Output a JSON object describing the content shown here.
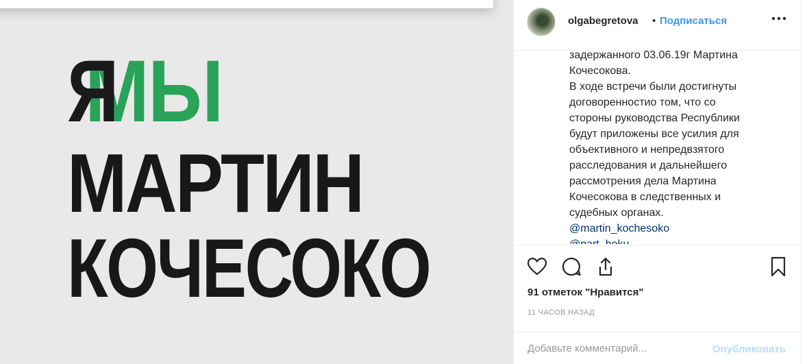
{
  "image": {
    "line1_ya": "Я",
    "line1_my": "МЫ",
    "line2": "МАРТИН",
    "line3": "КОЧЕСОКО",
    "colors": {
      "green": "#2bb25f",
      "black": "#181818",
      "background": "#e9e9ea"
    }
  },
  "post": {
    "username": "olgabegretova",
    "separator": "•",
    "follow_label": "Подписаться",
    "more_icon": "more-options-icon",
    "more_label": "•••"
  },
  "caption": {
    "lines": [
      "задержанного 03.06.19г Мартина",
      "Кочесокова.",
      "В ходе встречи были достигнуты",
      "договоренностио том, что со",
      "стороны руководства Республики",
      "будут приложены все усилия для",
      "объективного и непредвзятого",
      "расследования и дальнейшего",
      "рассмотрения дела Мартина",
      "Кочесокова в следственных и",
      "судебных органах."
    ],
    "mentions": [
      "@martin_kochesoko",
      "@part_boku"
    ]
  },
  "actions": {
    "icons": [
      "heart-icon",
      "comment-icon",
      "share-icon",
      "bookmark-icon"
    ],
    "likes": "91 отметок \"Нравится\"",
    "time": "11 ЧАСОВ НАЗАД"
  },
  "comment": {
    "placeholder": "Добавьте комментарий...",
    "publish_label": "Опубликовать"
  },
  "colors": {
    "accent": "#3897f0",
    "mention": "#003569",
    "muted": "#999999",
    "publish_disabled": "#b2dffc"
  }
}
